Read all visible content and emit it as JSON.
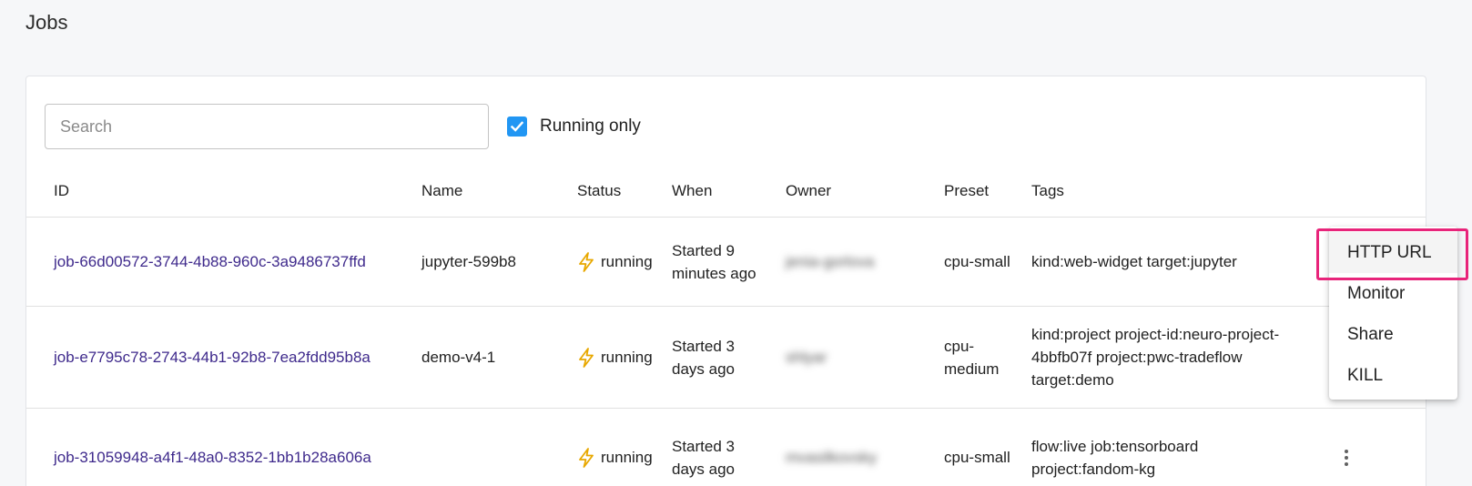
{
  "page": {
    "title": "Jobs"
  },
  "search": {
    "placeholder": "Search",
    "value": ""
  },
  "filter": {
    "running_only_label": "Running only",
    "checked": true
  },
  "table": {
    "columns": [
      "ID",
      "Name",
      "Status",
      "When",
      "Owner",
      "Preset",
      "Tags"
    ],
    "rows": [
      {
        "id": "job-66d00572-3744-4b88-960c-3a9486737ffd",
        "name": "jupyter-599b8",
        "status": "running",
        "when_line1": "Started 9",
        "when_line2": "minutes ago",
        "owner": "jenia-gorlova",
        "preset": "cpu-small",
        "tags": [
          "kind:web-widget target:jupyter"
        ]
      },
      {
        "id": "job-e7795c78-2743-44b1-92b8-7ea2fdd95b8a",
        "name": "demo-v4-1",
        "status": "running",
        "when_line1": "Started 3",
        "when_line2": "days ago",
        "owner": "shlyar",
        "preset_line1": "cpu-",
        "preset_line2": "medium",
        "tags": [
          "kind:project project-id:neuro-project-",
          "4bbfb07f project:pwc-tradeflow",
          "target:demo"
        ]
      },
      {
        "id": "job-31059948-a4f1-48a0-8352-1bb1b28a606a",
        "name": "",
        "status": "running",
        "when_line1": "Started 3",
        "when_line2": "days ago",
        "owner": "mvasilkovsky",
        "preset": "cpu-small",
        "tags": [
          "flow:live job:tensorboard",
          "project:fandom-kg"
        ]
      }
    ]
  },
  "context_menu": {
    "items": [
      "HTTP URL",
      "Monitor",
      "Share",
      "KILL"
    ],
    "highlighted_item": "HTTP URL"
  },
  "colors": {
    "accent": "#2196f3",
    "link": "#3f2a8c",
    "status_icon": "#f5b700",
    "highlight": "#e8247a"
  },
  "icons": {
    "status": "lightning-icon",
    "checkbox": "check-icon",
    "row_actions": "more-vert-icon"
  }
}
